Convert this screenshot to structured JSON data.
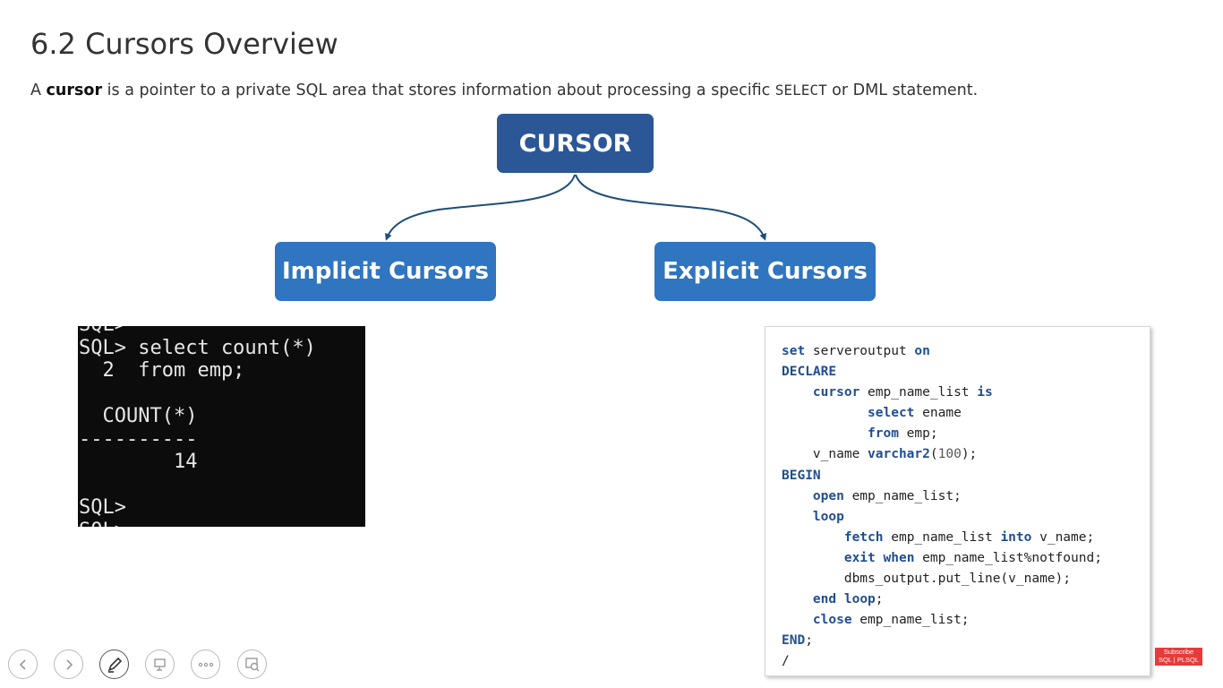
{
  "slide": {
    "title": "6.2 Cursors Overview",
    "intro": {
      "prefix": "A ",
      "bold": "cursor",
      "middle": " is a pointer to a private SQL area that stores information about processing a specific ",
      "code": "SELECT",
      "suffix": " or DML statement."
    }
  },
  "diagram": {
    "root": "CURSOR",
    "left": "Implicit Cursors",
    "right": "Explicit Cursors",
    "colors": {
      "root": "#2b5797",
      "child": "#2f75c0",
      "connector": "#1f4e79"
    }
  },
  "terminal": {
    "lines": [
      "SQL>",
      "SQL> select count(*)",
      "  2  from emp;",
      "",
      "  COUNT(*)",
      "----------",
      "        14",
      "",
      "SQL>",
      "SQL>"
    ]
  },
  "code_block": {
    "lines": [
      [
        {
          "t": "set",
          "k": "kw"
        },
        {
          "t": " serveroutput ",
          "k": "tx"
        },
        {
          "t": "on",
          "k": "kw"
        }
      ],
      [
        {
          "t": "DECLARE",
          "k": "kw"
        }
      ],
      [
        {
          "t": "    ",
          "k": "tx"
        },
        {
          "t": "cursor",
          "k": "kw"
        },
        {
          "t": " emp_name_list ",
          "k": "tx"
        },
        {
          "t": "is",
          "k": "kw"
        }
      ],
      [
        {
          "t": "           ",
          "k": "tx"
        },
        {
          "t": "select",
          "k": "kw"
        },
        {
          "t": " ename",
          "k": "tx"
        }
      ],
      [
        {
          "t": "           ",
          "k": "tx"
        },
        {
          "t": "from",
          "k": "kw"
        },
        {
          "t": " emp;",
          "k": "tx"
        }
      ],
      [
        {
          "t": "    v_name ",
          "k": "tx"
        },
        {
          "t": "varchar2",
          "k": "kw"
        },
        {
          "t": "(",
          "k": "tx"
        },
        {
          "t": "100",
          "k": "num"
        },
        {
          "t": ");",
          "k": "tx"
        }
      ],
      [
        {
          "t": "BEGIN",
          "k": "kw"
        }
      ],
      [
        {
          "t": "    ",
          "k": "tx"
        },
        {
          "t": "open",
          "k": "kw"
        },
        {
          "t": " emp_name_list;",
          "k": "tx"
        }
      ],
      [
        {
          "t": "    ",
          "k": "tx"
        },
        {
          "t": "loop",
          "k": "kw"
        }
      ],
      [
        {
          "t": "        ",
          "k": "tx"
        },
        {
          "t": "fetch",
          "k": "kw"
        },
        {
          "t": " emp_name_list ",
          "k": "tx"
        },
        {
          "t": "into",
          "k": "kw"
        },
        {
          "t": " v_name;",
          "k": "tx"
        }
      ],
      [
        {
          "t": "        ",
          "k": "tx"
        },
        {
          "t": "exit",
          "k": "kw"
        },
        {
          "t": " ",
          "k": "tx"
        },
        {
          "t": "when",
          "k": "kw"
        },
        {
          "t": " emp_name_list%notfound;",
          "k": "tx"
        }
      ],
      [
        {
          "t": "        dbms_output.put_line(v_name);",
          "k": "tx"
        }
      ],
      [
        {
          "t": "    ",
          "k": "tx"
        },
        {
          "t": "end",
          "k": "kw"
        },
        {
          "t": " ",
          "k": "tx"
        },
        {
          "t": "loop",
          "k": "kw"
        },
        {
          "t": ";",
          "k": "tx"
        }
      ],
      [
        {
          "t": "    ",
          "k": "tx"
        },
        {
          "t": "close",
          "k": "kw"
        },
        {
          "t": " emp_name_list;",
          "k": "tx"
        }
      ],
      [
        {
          "t": "END",
          "k": "kw"
        },
        {
          "t": ";",
          "k": "tx"
        }
      ],
      [
        {
          "t": "/",
          "k": "tx"
        }
      ]
    ]
  },
  "toolbar": {
    "buttons": [
      {
        "name": "previous-slide-button",
        "icon": "arrow-left-icon"
      },
      {
        "name": "next-slide-button",
        "icon": "arrow-right-icon"
      },
      {
        "name": "pen-tool-button",
        "icon": "pen-icon"
      },
      {
        "name": "slide-sorter-button",
        "icon": "slides-icon"
      },
      {
        "name": "more-options-button",
        "icon": "ellipsis-icon"
      },
      {
        "name": "zoom-button",
        "icon": "zoom-icon"
      }
    ]
  },
  "badge": {
    "line1": "Subscribe",
    "line2": "SQL | PLSQL",
    "color": "#e53b3b"
  }
}
